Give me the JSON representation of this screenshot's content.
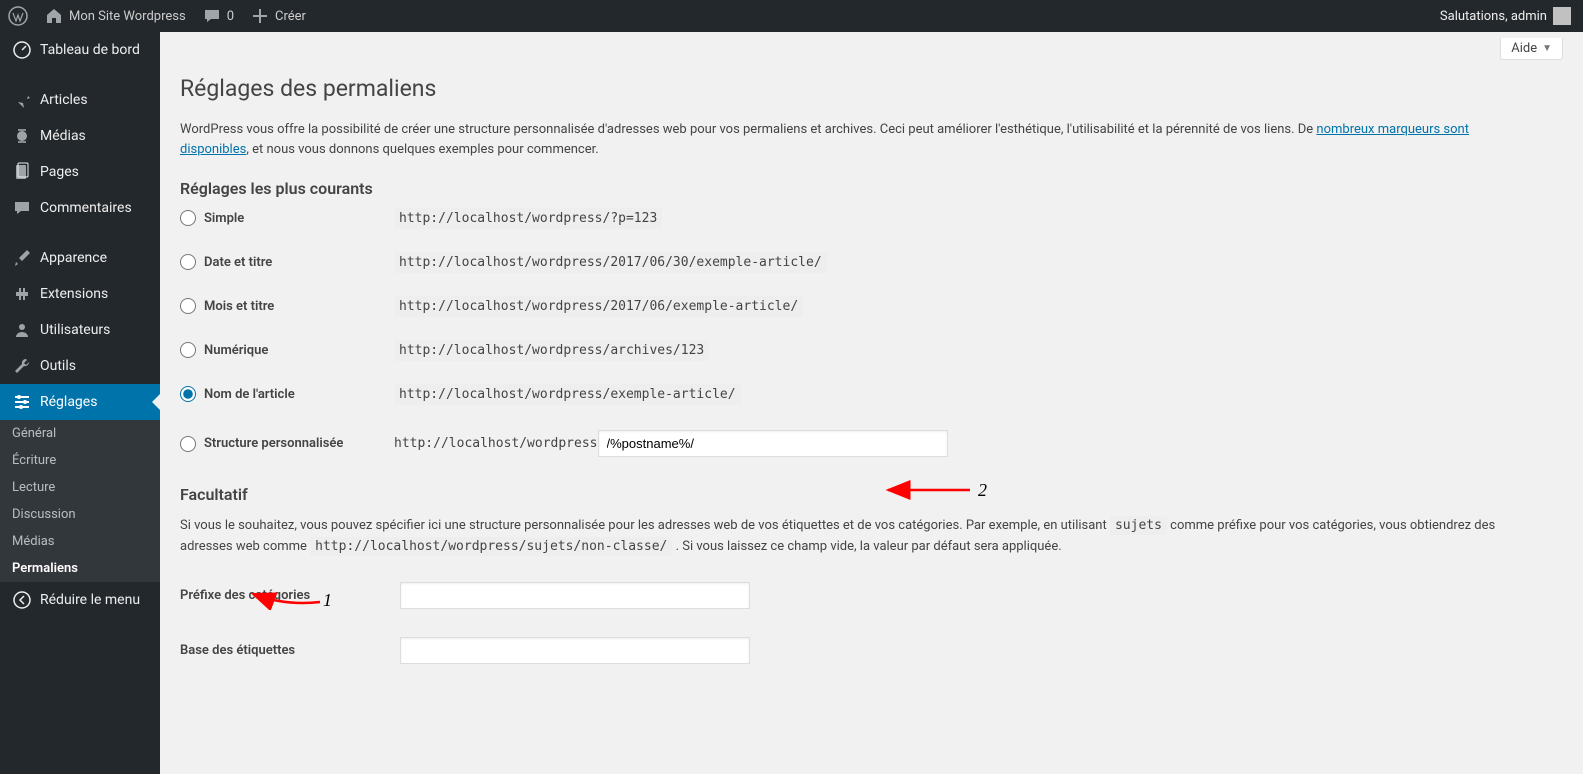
{
  "toolbar": {
    "site_name": "Mon Site Wordpress",
    "comments_count": "0",
    "create_label": "Créer",
    "greeting": "Salutations, admin"
  },
  "menu": {
    "dashboard": "Tableau de bord",
    "posts": "Articles",
    "media": "Médias",
    "pages": "Pages",
    "comments": "Commentaires",
    "appearance": "Apparence",
    "plugins": "Extensions",
    "users": "Utilisateurs",
    "tools": "Outils",
    "settings": "Réglages",
    "collapse": "Réduire le menu"
  },
  "submenu": {
    "general": "Général",
    "writing": "Écriture",
    "reading": "Lecture",
    "discussion": "Discussion",
    "media": "Médias",
    "permalinks": "Permaliens"
  },
  "help_label": "Aide",
  "page_title": "Réglages des permaliens",
  "intro_before": "WordPress vous offre la possibilité de créer une structure personnalisée d'adresses web pour vos permaliens et archives. Ceci peut améliorer l'esthétique, l'utilisabilité et la pérennité de vos liens. De ",
  "intro_link": "nombreux marqueurs sont disponibles",
  "intro_after": ", et nous vous donnons quelques exemples pour commencer.",
  "common_heading": "Réglages les plus courants",
  "options": {
    "simple": {
      "label": "Simple",
      "example": "http://localhost/wordpress/?p=123"
    },
    "date": {
      "label": "Date et titre",
      "example": "http://localhost/wordpress/2017/06/30/exemple-article/"
    },
    "month": {
      "label": "Mois et titre",
      "example": "http://localhost/wordpress/2017/06/exemple-article/"
    },
    "numeric": {
      "label": "Numérique",
      "example": "http://localhost/wordpress/archives/123"
    },
    "postname": {
      "label": "Nom de l'article",
      "example": "http://localhost/wordpress/exemple-article/"
    },
    "custom": {
      "label": "Structure personnalisée",
      "prefix": "http://localhost/wordpress",
      "value": "/%postname%/"
    }
  },
  "optional_heading": "Facultatif",
  "optional_text": {
    "a": "Si vous le souhaitez, vous pouvez spécifier ici une structure personnalisée pour les adresses web de vos étiquettes et de vos catégories. Par exemple, en utilisant ",
    "b": "sujets",
    "c": " comme préfixe pour vos catégories, vous obtiendrez des adresses web comme ",
    "d": "http://localhost/wordpress/sujets/non-classe/",
    "e": " . Si vous laissez ce champ vide, la valeur par défaut sera appliquée."
  },
  "cat_prefix_label": "Préfixe des catégories",
  "tag_base_label": "Base des étiquettes",
  "annotations": {
    "one": "1",
    "two": "2"
  }
}
